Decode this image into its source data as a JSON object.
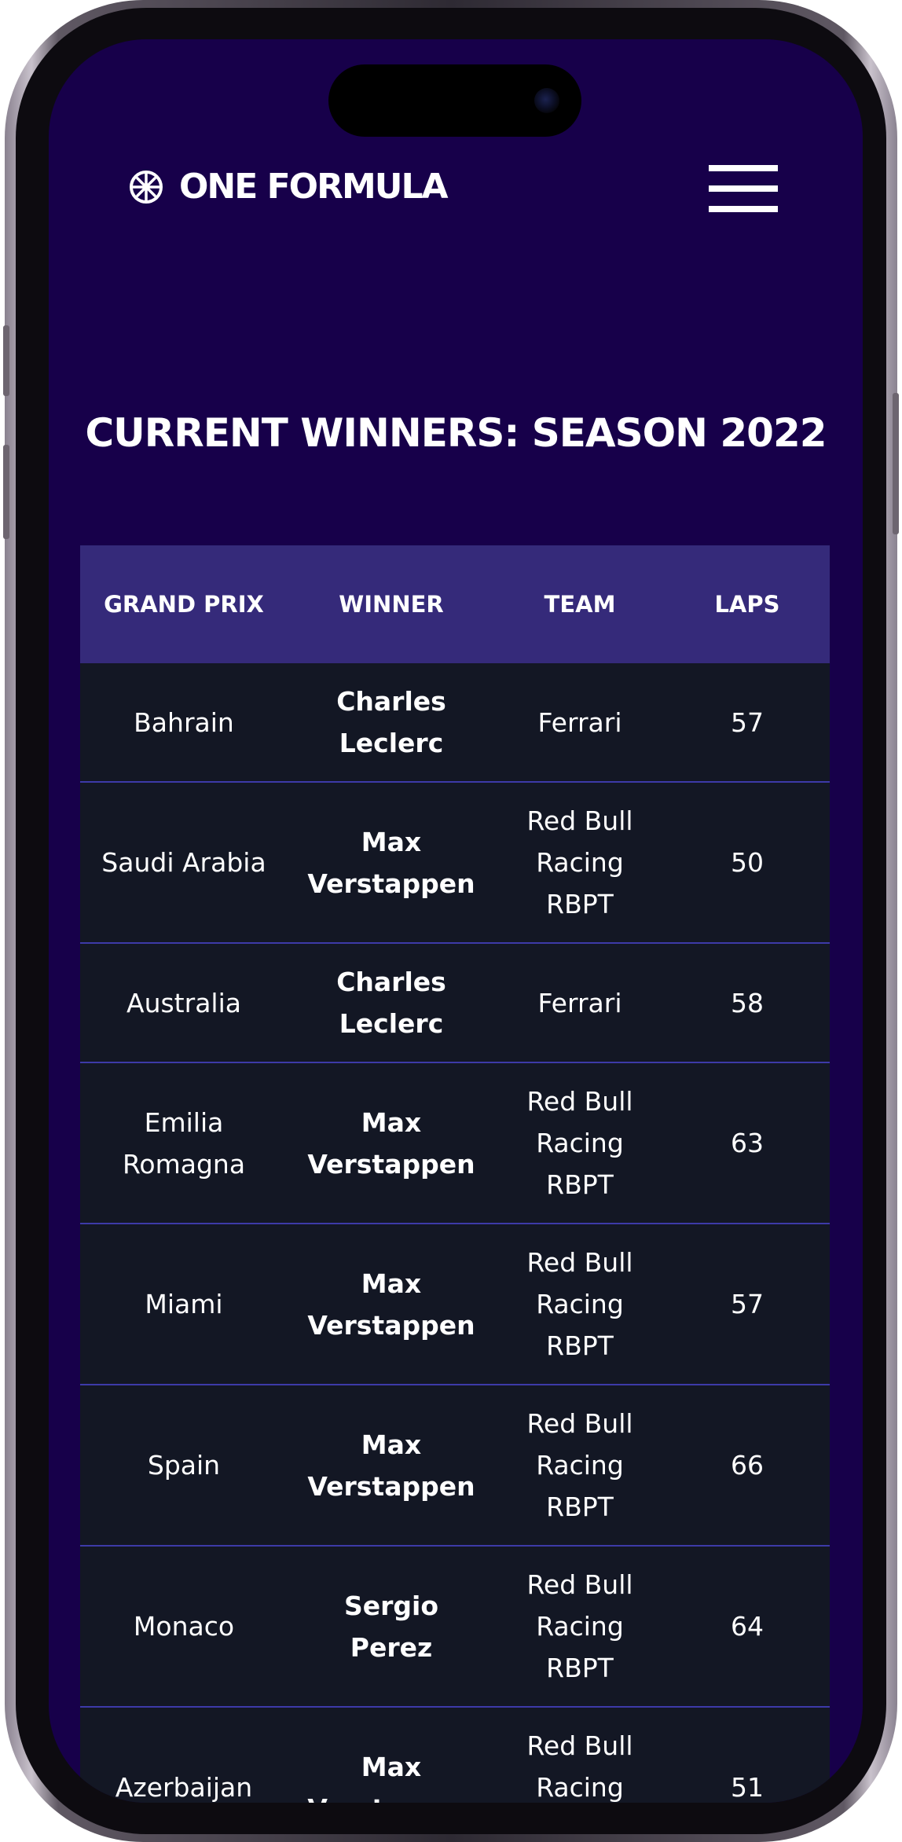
{
  "brand": {
    "name": "ONE FORMULA",
    "icon": "wheel-icon"
  },
  "header": {
    "menu_icon": "hamburger-menu-icon"
  },
  "page": {
    "title": "CURRENT WINNERS: SEASON 2022"
  },
  "table": {
    "headers": {
      "grand_prix": "GRAND PRIX",
      "winner": "WINNER",
      "team": "TEAM",
      "laps": "LAPS"
    },
    "rows": [
      {
        "grand_prix": "Bahrain",
        "winner": "Charles Leclerc",
        "team": "Ferrari",
        "laps": "57"
      },
      {
        "grand_prix": "Saudi Arabia",
        "winner": "Max Verstappen",
        "team": "Red Bull Racing RBPT",
        "laps": "50"
      },
      {
        "grand_prix": "Australia",
        "winner": "Charles Leclerc",
        "team": "Ferrari",
        "laps": "58"
      },
      {
        "grand_prix": "Emilia Romagna",
        "winner": "Max Verstappen",
        "team": "Red Bull Racing RBPT",
        "laps": "63"
      },
      {
        "grand_prix": "Miami",
        "winner": "Max Verstappen",
        "team": "Red Bull Racing RBPT",
        "laps": "57"
      },
      {
        "grand_prix": "Spain",
        "winner": "Max Verstappen",
        "team": "Red Bull Racing RBPT",
        "laps": "66"
      },
      {
        "grand_prix": "Monaco",
        "winner": "Sergio Perez",
        "team": "Red Bull Racing RBPT",
        "laps": "64"
      },
      {
        "grand_prix": "Azerbaijan",
        "winner": "Max Verstappen",
        "team": "Red Bull Racing RBPT",
        "laps": "51"
      }
    ]
  },
  "colors": {
    "background": "#17004a",
    "table_header": "#352a7a",
    "table_row": "#131724",
    "row_divider": "#3d3aa8",
    "text": "#ffffff"
  }
}
